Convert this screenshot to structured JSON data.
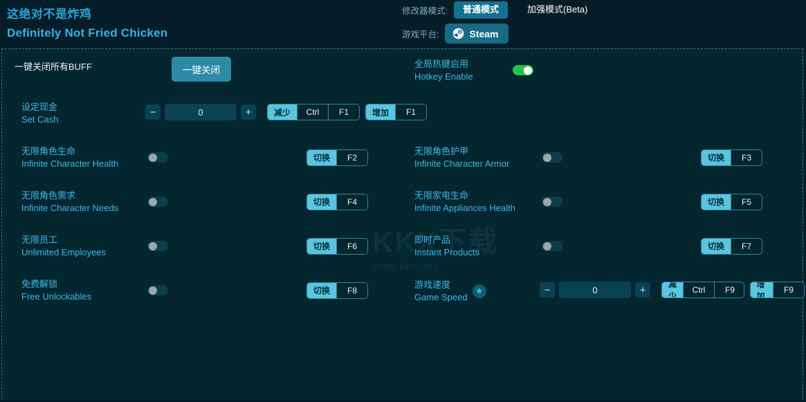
{
  "header": {
    "title_zh": "这绝对不是炸鸡",
    "title_en": "Definitely Not Fried Chicken",
    "mode_label": "修改器模式:",
    "mode_normal": "普通模式",
    "mode_enhanced": "加强模式(Beta)",
    "platform_label": "游戏平台:",
    "platform_name": "Steam"
  },
  "watermark": {
    "big": "KKX下载",
    "small": "www.kkx.net"
  },
  "topbar": {
    "close_all_zh": "一键关闭所有BUFF",
    "close_all_btn": "一键关闭",
    "hotkey_zh": "全局热键启用",
    "hotkey_en": "Hotkey Enable",
    "hotkey_state": "on"
  },
  "cash_row": {
    "zh": "设定现金",
    "en": "Set Cash",
    "value": "0",
    "minus": "−",
    "plus": "+",
    "dec_name": "减少",
    "dec_mod": "Ctrl",
    "dec_key": "F1",
    "inc_name": "增加",
    "inc_key": "F1"
  },
  "toggles": [
    {
      "zh": "无限角色生命",
      "en": "Infinite Character Health",
      "state": "off",
      "hk_name": "切换",
      "hk_key": "F2"
    },
    {
      "zh": "无限角色护甲",
      "en": "Infinite Character Armor",
      "state": "off",
      "hk_name": "切换",
      "hk_key": "F3"
    },
    {
      "zh": "无限角色需求",
      "en": "Infinite Character Needs",
      "state": "off",
      "hk_name": "切换",
      "hk_key": "F4"
    },
    {
      "zh": "无限家电生命",
      "en": "Infinite Appliances Health",
      "state": "off",
      "hk_name": "切换",
      "hk_key": "F5"
    },
    {
      "zh": "无限员工",
      "en": "Unlimited Employees",
      "state": "off",
      "hk_name": "切换",
      "hk_key": "F6"
    },
    {
      "zh": "即时产品",
      "en": "Instant Products",
      "state": "off",
      "hk_name": "切换",
      "hk_key": "F7"
    },
    {
      "zh": "免费解锁",
      "en": "Free Unlockables",
      "state": "off",
      "hk_name": "切换",
      "hk_key": "F8"
    }
  ],
  "speed_row": {
    "zh": "游戏速度",
    "en": "Game Speed",
    "value": "0",
    "minus": "−",
    "plus": "+",
    "dec_name": "减少",
    "dec_mod": "Ctrl",
    "dec_key": "F9",
    "inc_name": "增加",
    "inc_key": "F9"
  },
  "colors": {
    "background": "#041d28",
    "panel": "#04262f",
    "accent": "#3fb8e8",
    "accent_button": "#2d8ba8",
    "hotkey_chip": "#5bc4de",
    "toggle_on": "#22c24c"
  }
}
